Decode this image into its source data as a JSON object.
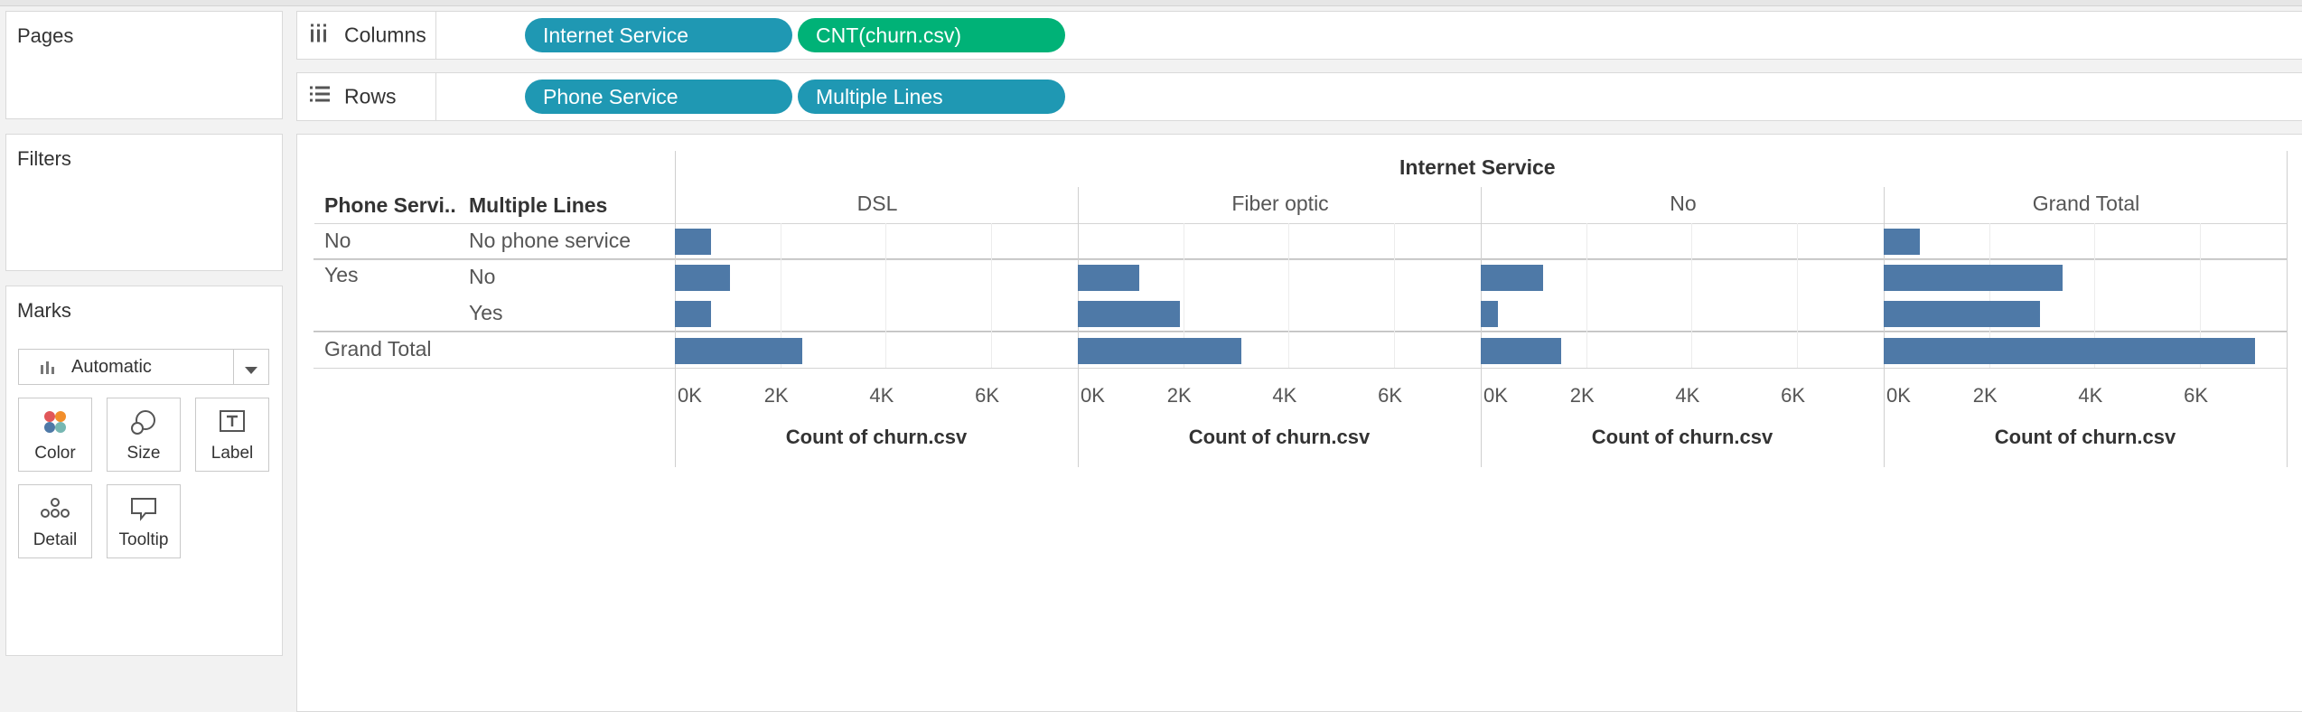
{
  "left_panel": {
    "pages_title": "Pages",
    "filters_title": "Filters",
    "marks_title": "Marks",
    "mark_type": "Automatic",
    "mark_buttons": [
      {
        "label": "Color",
        "icon": "color-dots-icon"
      },
      {
        "label": "Size",
        "icon": "size-circles-icon"
      },
      {
        "label": "Label",
        "icon": "label-text-icon"
      },
      {
        "label": "Detail",
        "icon": "detail-dots-icon"
      },
      {
        "label": "Tooltip",
        "icon": "tooltip-bubble-icon"
      }
    ]
  },
  "shelves": {
    "columns": {
      "label": "Columns",
      "icon": "columns-icon",
      "pills": [
        "Internet Service",
        "CNT(churn.csv)"
      ]
    },
    "rows": {
      "label": "Rows",
      "icon": "rows-icon",
      "pills": [
        "Phone Service",
        "Multiple Lines"
      ]
    }
  },
  "colors": {
    "dimension_pill": "#1f98b3",
    "measure_pill": "#00b277",
    "bar": "#4e79a7"
  },
  "view": {
    "top_header": "Internet Service",
    "row_header_1": "Phone Servi..",
    "row_header_2": "Multiple Lines",
    "column_headers": [
      "DSL",
      "Fiber optic",
      "No",
      "Grand Total"
    ],
    "row_labels": [
      {
        "phone": "No",
        "multi": "No phone service"
      },
      {
        "phone": "Yes",
        "multi": "No"
      },
      {
        "phone": "",
        "multi": "Yes"
      },
      {
        "phone": "Grand Total",
        "multi": ""
      }
    ],
    "axis_ticks": [
      "0K",
      "2K",
      "4K",
      "6K"
    ],
    "axis_title": "Count of churn.csv"
  },
  "chart_data": {
    "type": "bar",
    "orientation": "horizontal",
    "x_axis_range": [
      0,
      7300
    ],
    "x_axis_ticks": [
      0,
      2000,
      4000,
      6000
    ],
    "xlabel": "Count of churn.csv",
    "panels": [
      "DSL",
      "Fiber optic",
      "No",
      "Grand Total"
    ],
    "rows": [
      "No / No phone service",
      "Yes / No",
      "Yes / Yes",
      "Grand Total"
    ],
    "values": [
      [
        690,
        0,
        0,
        690
      ],
      [
        1050,
        1160,
        1180,
        3390
      ],
      [
        680,
        1940,
        320,
        2970
      ],
      [
        2420,
        3100,
        1530,
        7040
      ]
    ]
  }
}
